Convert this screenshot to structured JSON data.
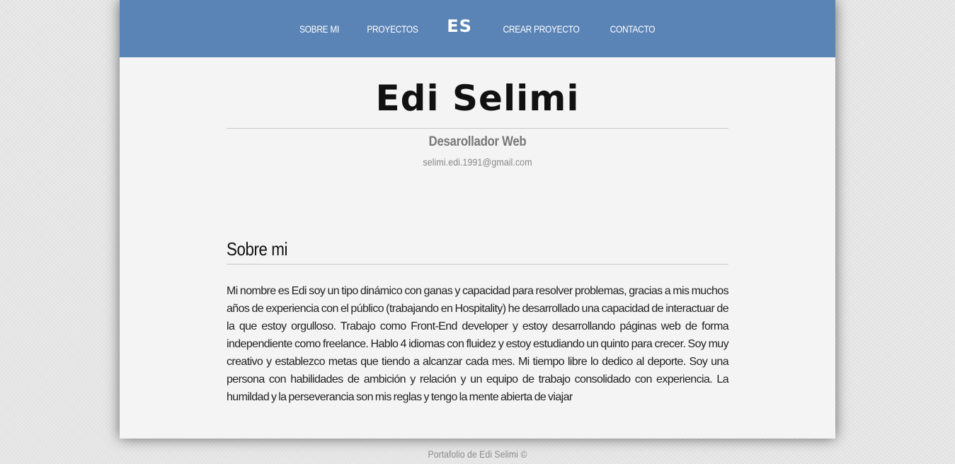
{
  "nav": {
    "items": [
      {
        "label": "SOBRE MI"
      },
      {
        "label": "PROYECTOS"
      },
      {
        "label": "ES"
      },
      {
        "label": "CREAR PROYECTO"
      },
      {
        "label": "CONTACTO"
      }
    ]
  },
  "header": {
    "name": "Edi Selimi",
    "role": "Desarollador Web",
    "email": "selimi.edi.1991@gmail.com"
  },
  "about": {
    "title": "Sobre mi",
    "text": "Mi nombre es Edi soy un tipo dinámico con ganas y capacidad para resolver problemas, gracias a mis muchos años de experiencia con el público (trabajando en Hospitality) he desarrollado una capacidad de interactuar de la que estoy orgulloso. Trabajo como Front-End developer y estoy desarrollando páginas web de forma independiente como freelance. Hablo 4 idiomas con fluidez y estoy estudiando un quinto para crecer. Soy muy creativo y establezco metas que tiendo a alcanzar cada mes. Mi tiempo libre lo dedico al deporte. Soy una persona con habilidades de ambición y relación y un equipo de trabajo consolidado con experiencia. La humildad y la perseverancia son mis reglas y tengo la mente abierta de viajar"
  },
  "footer": {
    "text": "Portafolio de Edi Selimi ©"
  },
  "colors": {
    "navbar": "#5b84b6",
    "card": "#f4f4f4",
    "background": "#e6e6e6"
  }
}
